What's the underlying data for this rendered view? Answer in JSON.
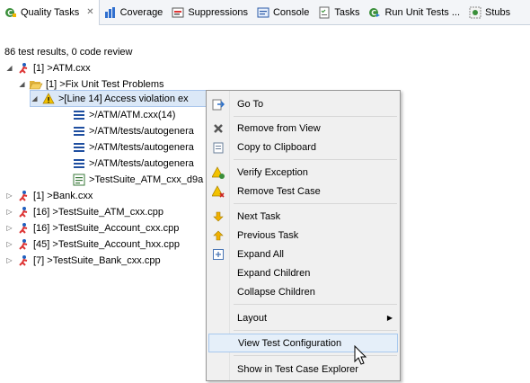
{
  "tabs": [
    {
      "label": "Quality Tasks",
      "icon": "quality-tasks-icon",
      "active": true
    },
    {
      "label": "Coverage",
      "icon": "coverage-icon"
    },
    {
      "label": "Suppressions",
      "icon": "suppressions-icon"
    },
    {
      "label": "Console",
      "icon": "console-icon"
    },
    {
      "label": "Tasks",
      "icon": "tasks-icon"
    },
    {
      "label": "Run Unit Tests ...",
      "icon": "run-unit-tests-icon"
    },
    {
      "label": "Stubs",
      "icon": "stubs-icon"
    }
  ],
  "status": "86 test results, 0 code review",
  "tree": {
    "r0": "[1] >ATM.cxx",
    "r1": "[1] >Fix Unit Test Problems",
    "r2": ">[Line 14] Access violation ex",
    "r3": ">/ATM/ATM.cxx(14)",
    "r4": ">/ATM/tests/autogenera",
    "r5": ">/ATM/tests/autogenera",
    "r6": ">/ATM/tests/autogenera",
    "r7": ">TestSuite_ATM_cxx_d9a",
    "r8": "[1] >Bank.cxx",
    "r9": "[16] >TestSuite_ATM_cxx.cpp",
    "r10": "[16] >TestSuite_Account_cxx.cpp",
    "r11": "[45] >TestSuite_Account_hxx.cpp",
    "r12": "[7] >TestSuite_Bank_cxx.cpp"
  },
  "menu": {
    "goto": "Go To",
    "remove_from_view": "Remove from View",
    "copy": "Copy to Clipboard",
    "verify_exception": "Verify Exception",
    "remove_test_case": "Remove Test Case",
    "next_task": "Next Task",
    "prev_task": "Previous Task",
    "expand_all": "Expand All",
    "expand_children": "Expand Children",
    "collapse_children": "Collapse Children",
    "layout": "Layout",
    "view_test_config": "View Test Configuration",
    "show_in_explorer": "Show in Test Case Explorer"
  },
  "colors": {
    "selection": "#dbe8f7",
    "menu_hover": "#e5eff9",
    "tab_bg": "#f3f5f8"
  }
}
